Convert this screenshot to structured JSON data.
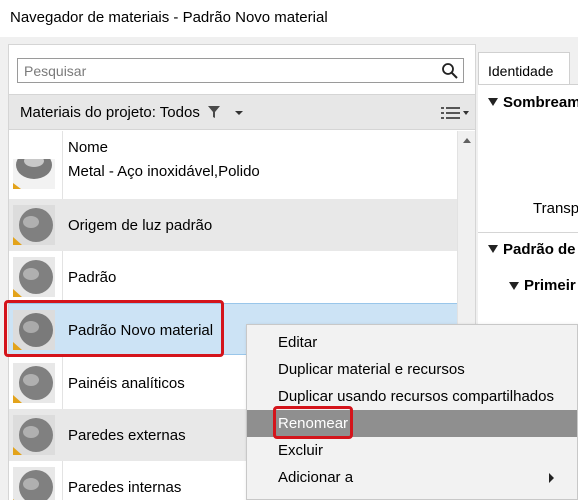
{
  "window": {
    "title": "Navegador de materiais - Padrão Novo material"
  },
  "search": {
    "placeholder": "Pesquisar",
    "value": ""
  },
  "filter": {
    "label": "Materiais do projeto: Todos"
  },
  "list": {
    "column_header": "Nome",
    "rows": [
      {
        "label": "Metal - Aço inoxidável,Polido"
      },
      {
        "label": "Origem de luz padrão"
      },
      {
        "label": "Padrão"
      },
      {
        "label": "Padrão Novo material"
      },
      {
        "label": "Painéis analíticos"
      },
      {
        "label": "Paredes externas"
      },
      {
        "label": "Paredes internas"
      }
    ],
    "selected_index": 3
  },
  "right_panel": {
    "tab": "Identidade",
    "section1": "Sombream",
    "field1": "Transpa",
    "section2": "Padrão de",
    "subsection": "Primeir"
  },
  "context_menu": {
    "items": [
      {
        "label": "Editar"
      },
      {
        "label": "Duplicar material e recursos"
      },
      {
        "label": "Duplicar usando recursos compartilhados"
      },
      {
        "label": "Renomear"
      },
      {
        "label": "Excluir"
      },
      {
        "label": "Adicionar a"
      }
    ],
    "hovered_index": 3
  },
  "colors": {
    "selection": "#cce3f5",
    "highlight": "#d4141b",
    "menu_hover": "#8f8f8f"
  }
}
